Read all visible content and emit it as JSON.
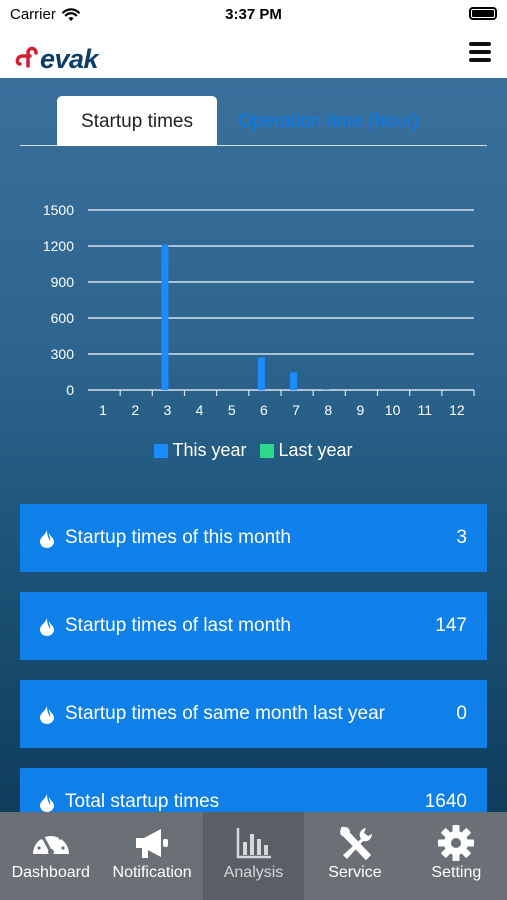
{
  "status_bar": {
    "carrier": "Carrier",
    "time": "3:37 PM"
  },
  "header": {
    "logo_text": "evak"
  },
  "tabs": [
    {
      "label": "Startup times",
      "active": true
    },
    {
      "label": "Operation time (hour)",
      "active": false
    }
  ],
  "chart_data": {
    "type": "bar",
    "categories": [
      "1",
      "2",
      "3",
      "4",
      "5",
      "6",
      "7",
      "8",
      "9",
      "10",
      "11",
      "12"
    ],
    "series": [
      {
        "name": "This year",
        "color": "#1a8cff",
        "values": [
          0,
          0,
          1210,
          0,
          0,
          270,
          147,
          3,
          0,
          0,
          0,
          0
        ]
      },
      {
        "name": "Last year",
        "color": "#2dd98a",
        "values": [
          0,
          0,
          0,
          0,
          0,
          0,
          0,
          0,
          0,
          0,
          0,
          0
        ]
      }
    ],
    "yticks": [
      0,
      300,
      600,
      900,
      1200,
      1500
    ],
    "ylim": [
      0,
      1500
    ],
    "grid": true,
    "legend": "bottom"
  },
  "cards": [
    {
      "label": "Startup times of this month",
      "value": "3"
    },
    {
      "label": "Startup times of last month",
      "value": "147"
    },
    {
      "label": "Startup times of same month last year",
      "value": "0"
    },
    {
      "label": "Total startup times",
      "value": "1640"
    }
  ],
  "nav": [
    {
      "label": "Dashboard",
      "icon": "speedometer-icon",
      "active": false
    },
    {
      "label": "Notification",
      "icon": "megaphone-icon",
      "active": false
    },
    {
      "label": "Analysis",
      "icon": "bar-chart-icon",
      "active": true
    },
    {
      "label": "Service",
      "icon": "tools-icon",
      "active": false
    },
    {
      "label": "Setting",
      "icon": "gear-icon",
      "active": false
    }
  ]
}
